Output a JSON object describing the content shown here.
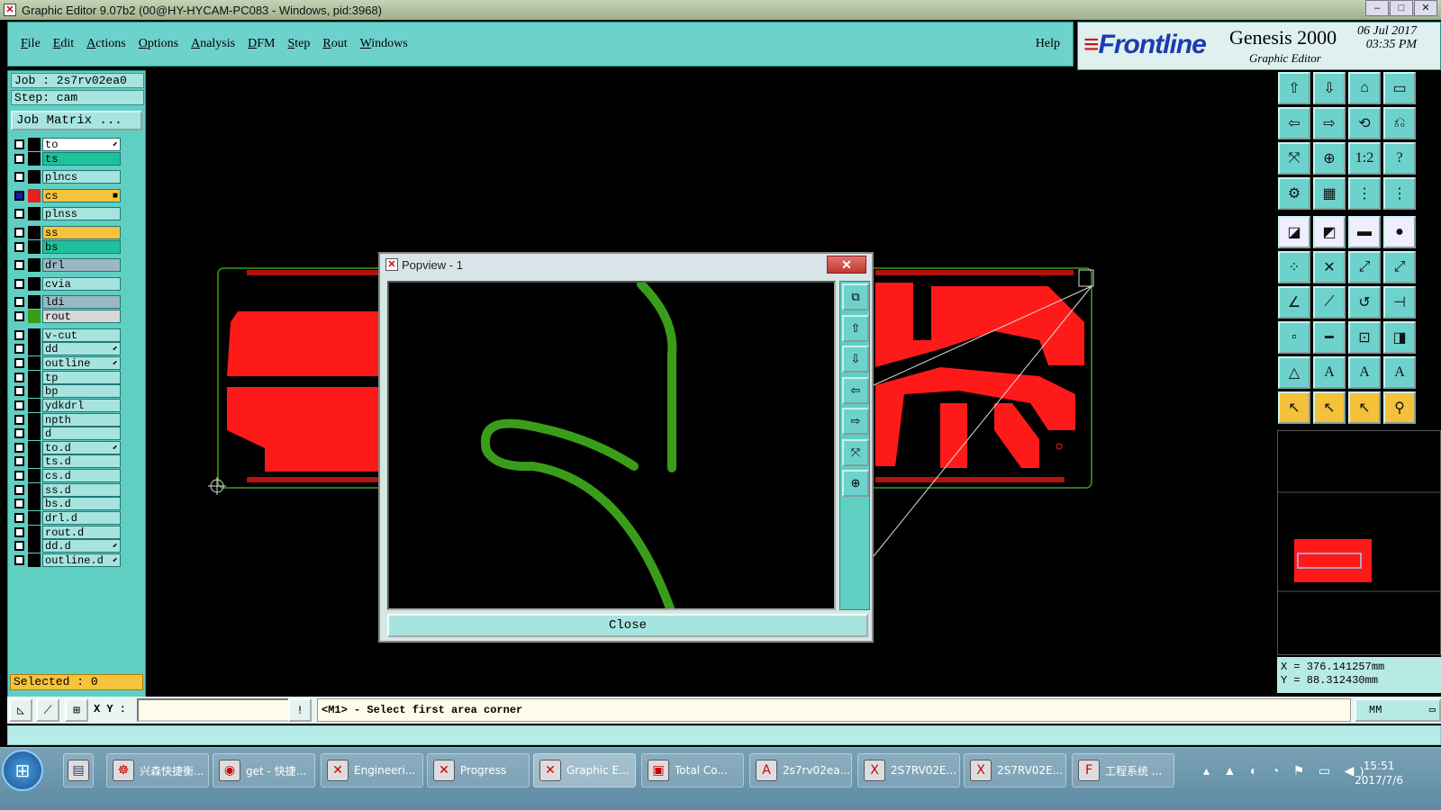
{
  "window_title": "Graphic Editor 9.07b2 (00@HY-HYCAM-PC083 - Windows, pid:3968)",
  "menu": [
    {
      "u": "F",
      "rest": "ile"
    },
    {
      "u": "E",
      "rest": "dit"
    },
    {
      "u": "A",
      "rest": "ctions"
    },
    {
      "u": "O",
      "rest": "ptions"
    },
    {
      "u": "A",
      "rest": "nalysis"
    },
    {
      "u": "D",
      "rest": "FM"
    },
    {
      "u": "S",
      "rest": "tep"
    },
    {
      "u": "R",
      "rest": "out"
    },
    {
      "u": "W",
      "rest": "indows"
    }
  ],
  "help_label": "Help",
  "brand": {
    "logo_e": "≡",
    "logo": "Frontline",
    "product": "Genesis 2000",
    "subtitle": "Graphic Editor",
    "date": "06 Jul 2017",
    "time": "03:35 PM"
  },
  "job": {
    "job_label": "Job : 2s7rv02ea0",
    "step_label": "Step: cam",
    "matrix_button": "Job Matrix ..."
  },
  "layers": [
    {
      "name": "to",
      "color": "#ffffff",
      "swatch": "#000000",
      "dot": "⬋",
      "checked": false
    },
    {
      "name": "ts",
      "color": "#1fc19a",
      "swatch": "#000000",
      "dot": "",
      "checked": false
    },
    {
      "name": "plncs",
      "color": "#a7e4df",
      "swatch": "#000000",
      "dot": "",
      "checked": false
    },
    {
      "name": "cs",
      "color": "#f8c23a",
      "swatch": "#e82020",
      "dot": "■",
      "checked": true
    },
    {
      "name": "plnss",
      "color": "#a7e4df",
      "swatch": "#000000",
      "dot": "",
      "checked": false
    },
    {
      "name": "ss",
      "color": "#f8c23a",
      "swatch": "#000000",
      "dot": "",
      "checked": false
    },
    {
      "name": "bs",
      "color": "#1fc19a",
      "swatch": "#000000",
      "dot": "",
      "checked": false
    },
    {
      "name": "drl",
      "color": "#9ab8c0",
      "swatch": "#000000",
      "dot": "",
      "checked": false
    },
    {
      "name": "cvia",
      "color": "#a7e4df",
      "swatch": "#000000",
      "dot": "",
      "checked": false
    },
    {
      "name": "ldi",
      "color": "#9ab8c0",
      "swatch": "#000000",
      "dot": "",
      "checked": false
    },
    {
      "name": "rout",
      "color": "#d8d8d8",
      "swatch": "#3a9d1a",
      "dot": "",
      "checked": false
    },
    {
      "name": "v-cut",
      "color": "#a7e4df",
      "swatch": "#000000",
      "dot": "",
      "checked": false
    },
    {
      "name": "dd",
      "color": "#a7e4df",
      "swatch": "#000000",
      "dot": "⬋",
      "checked": false
    },
    {
      "name": "outline",
      "color": "#a7e4df",
      "swatch": "#000000",
      "dot": "⬋",
      "checked": false
    },
    {
      "name": "tp",
      "color": "#a7e4df",
      "swatch": "#000000",
      "dot": "",
      "checked": false
    },
    {
      "name": "bp",
      "color": "#a7e4df",
      "swatch": "#000000",
      "dot": "",
      "checked": false
    },
    {
      "name": "ydkdrl",
      "color": "#a7e4df",
      "swatch": "#000000",
      "dot": "",
      "checked": false
    },
    {
      "name": "npth",
      "color": "#a7e4df",
      "swatch": "#000000",
      "dot": "",
      "checked": false
    },
    {
      "name": "d",
      "color": "#a7e4df",
      "swatch": "#000000",
      "dot": "",
      "checked": false
    },
    {
      "name": "to.d",
      "color": "#a7e4df",
      "swatch": "#000000",
      "dot": "⬋",
      "checked": false
    },
    {
      "name": "ts.d",
      "color": "#a7e4df",
      "swatch": "#000000",
      "dot": "",
      "checked": false
    },
    {
      "name": "cs.d",
      "color": "#a7e4df",
      "swatch": "#000000",
      "dot": "",
      "checked": false
    },
    {
      "name": "ss.d",
      "color": "#a7e4df",
      "swatch": "#000000",
      "dot": "",
      "checked": false
    },
    {
      "name": "bs.d",
      "color": "#a7e4df",
      "swatch": "#000000",
      "dot": "",
      "checked": false
    },
    {
      "name": "drl.d",
      "color": "#a7e4df",
      "swatch": "#000000",
      "dot": "",
      "checked": false
    },
    {
      "name": "rout.d",
      "color": "#a7e4df",
      "swatch": "#000000",
      "dot": "",
      "checked": false
    },
    {
      "name": "dd.d",
      "color": "#a7e4df",
      "swatch": "#000000",
      "dot": "⬋",
      "checked": false
    },
    {
      "name": "outline.d",
      "color": "#a7e4df",
      "swatch": "#000000",
      "dot": "⬋",
      "checked": false
    }
  ],
  "selected_label": "Selected : 0",
  "popup": {
    "title": "Popview - 1",
    "close_x": "✕",
    "close_button": "Close"
  },
  "coords": {
    "x": "X = 376.141257mm",
    "y": "Y = 88.312430mm"
  },
  "cmd": {
    "xy_label": "X Y :",
    "xy_value": "",
    "message": "<M1> - Select first area corner",
    "unit": "MM"
  },
  "taskbar": {
    "start_icon": "⊞",
    "tasks": [
      {
        "label": "兴森快捷衡...",
        "icon": "☸",
        "active": false
      },
      {
        "label": "get - 快捷...",
        "icon": "◉",
        "active": false
      },
      {
        "label": "Engineeri...",
        "icon": "✕",
        "active": false
      },
      {
        "label": "Progress",
        "icon": "✕",
        "active": false
      },
      {
        "label": "Graphic E...",
        "icon": "✕",
        "active": true
      },
      {
        "label": "Total Co...",
        "icon": "▣",
        "active": false
      },
      {
        "label": "2s7rv02ea...",
        "icon": "A",
        "active": false
      },
      {
        "label": "2S7RV02E...",
        "icon": "X",
        "active": false
      },
      {
        "label": "2S7RV02E...",
        "icon": "X",
        "active": false
      },
      {
        "label": "工程系统 ...",
        "icon": "F",
        "active": false
      }
    ],
    "tray": "▴ ▲ ◐ ◔ ⚑ ▭ ◀)",
    "time": "15:51",
    "date": "2017/7/6"
  },
  "colors": {
    "accent": "#6ed2cc",
    "copper": "#ff1a1a",
    "rout": "#3a9d1a"
  }
}
